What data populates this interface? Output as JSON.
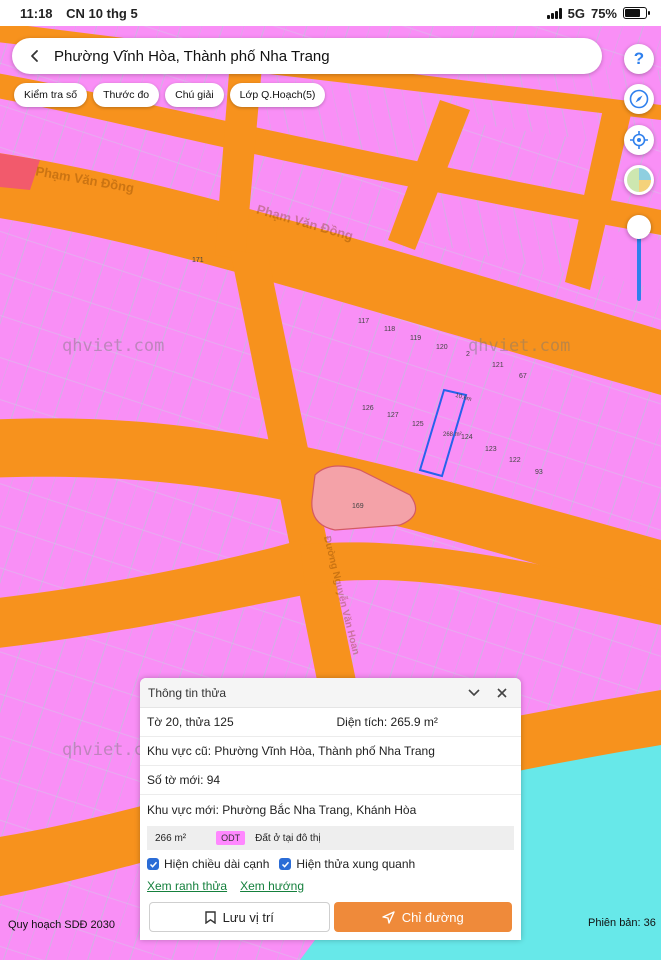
{
  "status_bar": {
    "time": "11:18",
    "date": "CN 10 thg 5",
    "network": "5G",
    "battery": "75%",
    "battery_level": 0.75
  },
  "search": {
    "title": "Phường Vĩnh Hòa, Thành phố Nha Trang"
  },
  "toolbar": {
    "chips": [
      "Kiểm tra số",
      "Thước đo",
      "Chú giải",
      "Lớp Q.Hoạch(5)"
    ]
  },
  "side_buttons": {
    "help": "?"
  },
  "map": {
    "watermark": "qhviet.com",
    "streets": [
      "Phạm Văn Đồng",
      "Phạm Văn Đồng",
      "Đường Nguyễn Văn Hoan"
    ],
    "parcels": [
      "171",
      "117",
      "118",
      "119",
      "120",
      "2",
      "121",
      "67",
      "126",
      "127",
      "125",
      "124",
      "123",
      "122",
      "93",
      "169",
      "268 m²",
      "10.6m"
    ],
    "map_title": "Quy hoạch SDĐ 2030",
    "version": "Phiên bản: 36"
  },
  "panel": {
    "title": "Thông tin thửa",
    "sheet_parcel": "Tờ 20, thửa 125",
    "area": "Diện tích: 265.9 m²",
    "old_area": "Khu vực cũ: Phường Vĩnh Hòa, Thành phố Nha Trang",
    "new_sheet": "Số tờ mới: 94",
    "new_area": "Khu vực mới: Phường Bắc Nha Trang, Khánh Hòa",
    "land_use": {
      "size": "266 m²",
      "code": "ODT",
      "desc": "Đất ở tại đô thị"
    },
    "check_edges": "Hiện chiều dài cạnh",
    "check_neighbors": "Hiện thửa xung quanh",
    "link_boundary": "Xem ranh thửa",
    "link_direction": "Xem hướng",
    "save_label": "Lưu vị trí",
    "route_label": "Chỉ đường"
  },
  "colors": {
    "residential": "#f98ff6",
    "road": "#f7921d",
    "water": "#67e8e9",
    "accent_button": "#ef8a3a",
    "selected_outline": "#2563eb"
  }
}
